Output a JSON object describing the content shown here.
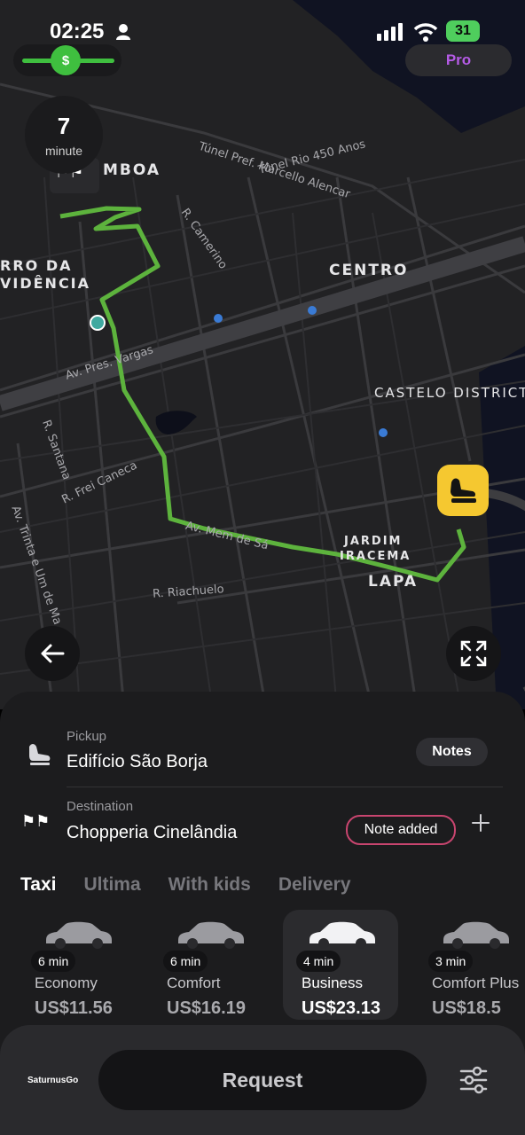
{
  "status_bar": {
    "time": "02:25",
    "battery": "31"
  },
  "header": {
    "pro_label": "Pro",
    "ride_timer_value": "7",
    "ride_timer_unit": "minute"
  },
  "map": {
    "labels": {
      "mboa": "MBOA",
      "morro": "RRO DA",
      "providencia": "VIDÊNCIA",
      "centro": "CENTRO",
      "castelo": "CASTELO DISTRICT",
      "jardim1": "JARDIM",
      "jardim2": "IRACEMA",
      "lapa": "LAPA"
    },
    "streets": {
      "tunel": "Túnel Rio 450 Anos",
      "marcello": "Túnel Pref. Marcello Alencar",
      "camerino": "R. Camerino",
      "vargas": "Av. Pres. Vargas",
      "santana": "R. Santana",
      "frei": "R. Frei Caneca",
      "trinta": "Av. Trinta e Um de Ma",
      "riachuelo": "R. Riachuelo",
      "memde": "Av. Mem de Sá"
    },
    "route_color": "#5db33d",
    "pickup_pin_color": "#f5c830"
  },
  "trip": {
    "pickup_label": "Pickup",
    "pickup_value": "Edifício São Borja",
    "notes_button": "Notes",
    "destination_label": "Destination",
    "destination_value": "Chopperia Cinelândia",
    "note_added_button": "Note added",
    "add_stop_icon": "plus-icon"
  },
  "tabs": [
    {
      "label": "Taxi",
      "active": true
    },
    {
      "label": "Ultima",
      "active": false
    },
    {
      "label": "With kids",
      "active": false
    },
    {
      "label": "Delivery",
      "active": false
    }
  ],
  "ride_options": [
    {
      "eta": "6 min",
      "name": "Economy",
      "price": "US$11.56",
      "selected": false
    },
    {
      "eta": "6 min",
      "name": "Comfort",
      "price": "US$16.19",
      "selected": false
    },
    {
      "eta": "4 min",
      "name": "Business",
      "price": "US$23.13",
      "selected": true
    },
    {
      "eta": "3 min",
      "name": "Comfort Plus",
      "price": "US$18.5",
      "selected": false
    }
  ],
  "footer": {
    "brand": "SaturnusGo",
    "request_label": "Request",
    "settings_icon": "sliders-icon"
  }
}
